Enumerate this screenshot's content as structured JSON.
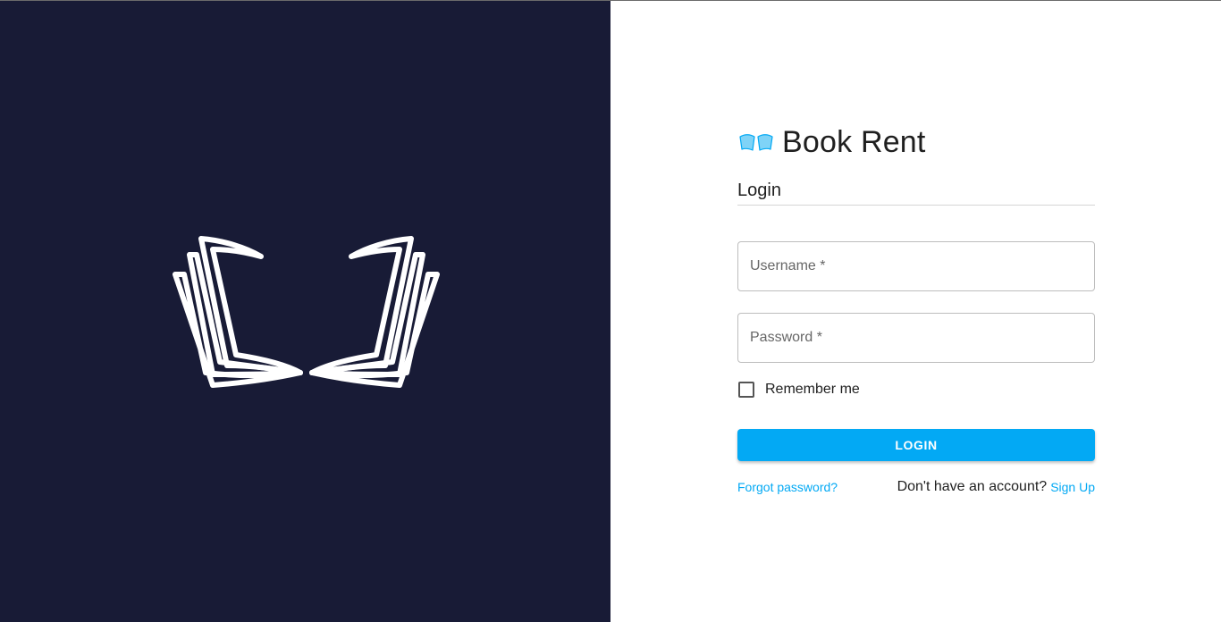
{
  "brand": {
    "name": "Book Rent",
    "icon": "open-book-icon",
    "accent_color": "#03a9f4"
  },
  "left_panel": {
    "background_color": "#181b36",
    "logo_icon": "open-book-outline-icon"
  },
  "form": {
    "title": "Login",
    "username_label": "Username *",
    "password_label": "Password *",
    "remember_label": "Remember me",
    "remember_checked": false,
    "submit_label": "LOGIN",
    "forgot_link": "Forgot password?",
    "signup_prompt": "Don't have an account?",
    "signup_link": "Sign Up"
  }
}
